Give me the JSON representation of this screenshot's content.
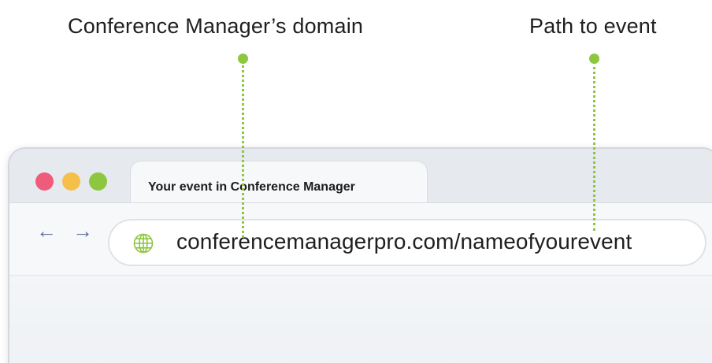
{
  "annotations": {
    "domain_label": "Conference Manager’s domain",
    "path_label": "Path to event",
    "callout_color": "#8dc63f"
  },
  "browser": {
    "window_controls": [
      {
        "name": "close",
        "color": "#ef5b7b"
      },
      {
        "name": "minimize",
        "color": "#f4c04a"
      },
      {
        "name": "maximize",
        "color": "#8dc63f"
      }
    ],
    "tab_title": "Your event in Conference Manager",
    "back_icon": "arrow-left-icon",
    "forward_icon": "arrow-right-icon",
    "back_glyph": "←",
    "forward_glyph": "→",
    "address_icon": "globe-icon",
    "address_icon_color": "#8dc63f",
    "url": "conferencemanagerpro.com/nameofyourevent"
  }
}
